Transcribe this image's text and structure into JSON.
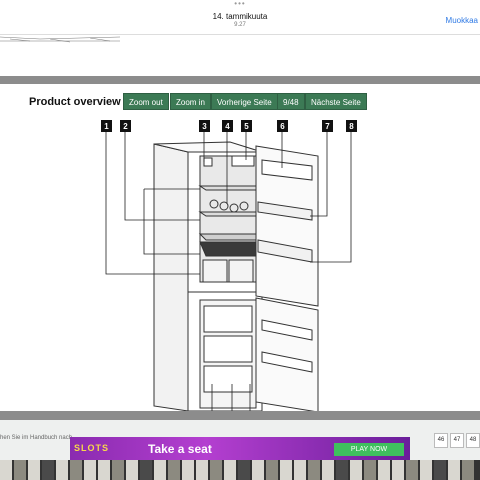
{
  "top_bar": {
    "dots": "•••",
    "date": "14. tammikuuta",
    "time": "9.27",
    "edit_label": "Muokkaa"
  },
  "document": {
    "title": "Product overview",
    "nav_buttons": [
      "Zoom out",
      "Zoom in",
      "Vorherige Seite",
      "9/48",
      "Nächste Seite"
    ],
    "callouts": [
      "1",
      "2",
      "3",
      "4",
      "5",
      "6",
      "7",
      "8"
    ]
  },
  "pager": {
    "hint": "hen Sie im Handbuch nach",
    "pages": [
      "46",
      "47",
      "48"
    ]
  },
  "ad": {
    "left_text": "SLOTS",
    "text": "Take a seat",
    "button": "PLAY NOW"
  }
}
